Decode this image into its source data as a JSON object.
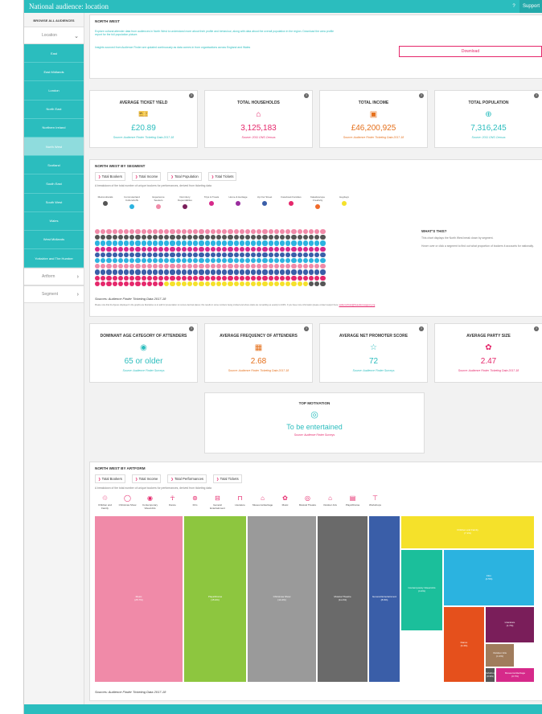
{
  "app": {
    "title": "National audience: location",
    "help": "?",
    "support": "Support"
  },
  "sidebar": {
    "header": "BROWSE ALL AUDIENCES",
    "location_label": "Location",
    "regions": [
      "East",
      "East Midlands",
      "London",
      "North East",
      "Northern Ireland",
      "North West",
      "Scotland",
      "South East",
      "South West",
      "Wales",
      "West Midlands",
      "Yorkshire and The Humber"
    ],
    "active_region": "North West",
    "artform_label": "Artform",
    "segment_label": "Segment"
  },
  "intro": {
    "title": "NORTH WEST",
    "text1": "Explore cultural attender data from audiences in North West to understand more about their profile and behaviour, along with data about the overall population in the region. Download the area profile report for the full population picture.",
    "text2": "Insights sourced from Audience Finder are updated continuously as data comes in from organisations across England and Wales",
    "download": "Download"
  },
  "stats1": [
    {
      "heading": "AVERAGE TICKET YIELD",
      "icon": "ticket-icon",
      "value": "£20.89",
      "source": "Source: Audience Finder Ticketing Data 2017-18"
    },
    {
      "heading": "TOTAL HOUSEHOLDS",
      "icon": "house-icon",
      "value": "3,125,183",
      "source": "Source: 2011 ONS Census"
    },
    {
      "heading": "TOTAL INCOME",
      "icon": "money-icon",
      "value": "£46,200,925",
      "source": "Source: Audience Finder Ticketing Data 2017-18"
    },
    {
      "heading": "TOTAL POPULATION",
      "icon": "globe-icon",
      "value": "7,316,245",
      "source": "Source: 2011 ONS Census"
    }
  ],
  "segment": {
    "title": "NORTH WEST BY SEGMENT",
    "tabs": [
      "Total Bookers",
      "Total Income",
      "Total Population",
      "Total Tickets"
    ],
    "desc": "A breakdown of the total number of unique bookers for performances, derived from ticketing data",
    "legend": [
      {
        "name": "Metroculturals",
        "color": "#555555"
      },
      {
        "name": "Commuterland Culturebuffs",
        "color": "#2bb3e0"
      },
      {
        "name": "Experience Seekers",
        "color": "#f08aa8"
      },
      {
        "name": "Dormitory Dependables",
        "color": "#7a1e5a"
      },
      {
        "name": "Trips & Treats",
        "color": "#d6298a"
      },
      {
        "name": "Home & Heritage",
        "color": "#9a2c9e"
      },
      {
        "name": "Up Our Street",
        "color": "#3a5ea8"
      },
      {
        "name": "Facebook Families",
        "color": "#e5276b"
      },
      {
        "name": "Kaleidoscope Creativity",
        "color": "#f06a2a"
      },
      {
        "name": "Heydays",
        "color": "#f5e12a"
      }
    ],
    "whats_title": "WHAT'S THIS?",
    "whats_text1": "This chart displays the North West break down by segment.",
    "whats_text2": "Hover over or click a segment to find out what proportion of bookers it accounts for nationally.",
    "source": "Sources: Audience Finder Ticketing Data 2017-18",
    "note": "Please note that the figures displayed in the graphs are illustrative so to add for presentation to remove decimal places; this results in some numbers being omitted and where totals are not adding up exactly to 100%. If you have more information please contact support here:",
    "note_link": "audiencefinder@theaudienceagency.org"
  },
  "stats2": [
    {
      "heading": "DOMINANT AGE CATEGORY OF ATTENDERS",
      "icon": "age-icon",
      "value": "65 or older",
      "source": "Source: Audience Finder Surveys",
      "color": "#2bbdbe"
    },
    {
      "heading": "AVERAGE FREQUENCY OF ATTENDERS",
      "icon": "calendar-icon",
      "value": "2.68",
      "source": "Source: Audience Finder Ticketing Data 2017-18",
      "color": "#e5701c"
    },
    {
      "heading": "AVERAGE NET PROMOTER SCORE",
      "icon": "rating-icon",
      "value": "72",
      "source": "Source: Audience Finder Surveys",
      "color": "#2bbdbe"
    },
    {
      "heading": "AVERAGE PARTY SIZE",
      "icon": "group-icon",
      "value": "2.47",
      "source": "Source: Audience Finder Ticketing Data 2017-18",
      "color": "#e5276b"
    }
  ],
  "motivation": {
    "heading": "TOP MOTIVATION",
    "value": "To be entertained",
    "source": "Source: Audience Finder Surveys"
  },
  "artform": {
    "title": "NORTH WEST BY ARTFORM",
    "tabs": [
      "Total Bookers",
      "Total Income",
      "Total Performances",
      "Total Tickets"
    ],
    "desc": "A breakdown of the total number of unique bookers for performances, derived from ticketing data",
    "items": [
      "Children and Family",
      "Christmas Show",
      "Contemporary Visual Arts",
      "Dance",
      "Film",
      "General Entertainment",
      "Literature",
      "Museums/Heritage",
      "Music",
      "Musical Theatre",
      "Outdoor Arts",
      "Plays/Drama",
      "Workshops"
    ],
    "source": "Sources: Audience Finder Ticketing Data 2017-18"
  },
  "chart_data": {
    "type": "treemap",
    "series": [
      {
        "name": "Music",
        "percent": "25.7%",
        "color": "#f08aa8"
      },
      {
        "name": "Plays/Drama",
        "percent": "15.9%",
        "color": "#8dc63f"
      },
      {
        "name": "Christmas Show",
        "percent": "14.4%",
        "color": "#9a9a9a"
      },
      {
        "name": "Musical Theatre",
        "percent": "11.4%",
        "color": "#6a6a6a"
      },
      {
        "name": "General Entertainment",
        "percent": "8.9%",
        "color": "#3a5ea8"
      },
      {
        "name": "Children and Family",
        "percent": "7.1%",
        "color": "#f5e12a"
      },
      {
        "name": "Film",
        "percent": "4.5%",
        "color": "#2bb3e0"
      },
      {
        "name": "Contemporary Visual Arts",
        "percent": "3.4%",
        "color": "#1bbf9b"
      },
      {
        "name": "Dance",
        "percent": "3.4%",
        "color": "#e5501c"
      },
      {
        "name": "Literature",
        "percent": "1.7%",
        "color": "#7a1e5a"
      },
      {
        "name": "Outdoor Arts",
        "percent": "1.1%",
        "color": "#a07c5c"
      },
      {
        "name": "Workshops",
        "percent": "0.9%",
        "color": "#555555"
      },
      {
        "name": "Museums/Heritage",
        "percent": "0.7%",
        "color": "#d6298a"
      }
    ]
  }
}
